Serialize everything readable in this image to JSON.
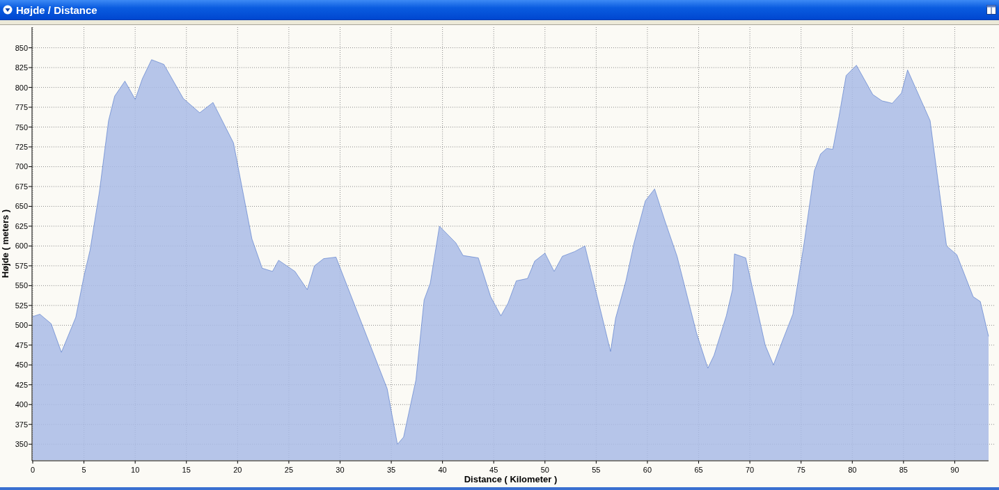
{
  "window": {
    "title": "Højde / Distance"
  },
  "chart": {
    "chart_data": {
      "type": "area",
      "xlabel": "Distance ( Kilometer )",
      "ylabel": "Højde ( meters )",
      "x": [
        0,
        0.7,
        1.8,
        2.8,
        4.2,
        5,
        5.6,
        6.5,
        7.4,
        8,
        9,
        10,
        10.7,
        11.6,
        12.8,
        14.7,
        16.3,
        17.6,
        19.6,
        21.4,
        22.4,
        23.4,
        24,
        25.6,
        26.8,
        27.5,
        28.4,
        29.6,
        34.6,
        35.6,
        36.2,
        37.4,
        38.2,
        38.8,
        39.7,
        41.3,
        42,
        43.5,
        44.7,
        45.7,
        46.4,
        47.2,
        48.3,
        49,
        50,
        50.9,
        51.7,
        52.9,
        53.9,
        56.4,
        56.9,
        57.9,
        58.7,
        59.8,
        60.7,
        61.7,
        62.9,
        64.8,
        65.9,
        66.5,
        67.7,
        68.3,
        68.5,
        69.6,
        71.5,
        72.3,
        73.2,
        74.2,
        75.3,
        76.3,
        76.9,
        77.5,
        78.1,
        78.7,
        79.4,
        80.4,
        82,
        82.9,
        83.9,
        84.8,
        85.4,
        87.6,
        89.2,
        90.2,
        91.8,
        92.5,
        93.3
      ],
      "values": [
        511,
        514,
        502,
        466,
        510,
        562,
        595,
        668,
        758,
        789,
        808,
        785,
        811,
        835,
        829,
        786,
        768,
        781,
        730,
        609,
        572,
        568,
        582,
        568,
        545,
        575,
        584,
        586,
        420,
        350,
        359,
        431,
        532,
        553,
        625,
        604,
        588,
        585,
        536,
        512,
        528,
        556,
        559,
        581,
        591,
        568,
        587,
        593,
        600,
        467,
        509,
        556,
        604,
        657,
        672,
        632,
        587,
        490,
        446,
        462,
        512,
        545,
        590,
        585,
        475,
        450,
        481,
        514,
        604,
        695,
        716,
        723,
        722,
        763,
        815,
        828,
        791,
        783,
        780,
        793,
        822,
        758,
        600,
        589,
        536,
        530,
        486
      ],
      "grid": true,
      "xlim": [
        0,
        93.3
      ],
      "ylim": [
        330,
        876
      ],
      "xticks": [
        0,
        5,
        10,
        15,
        20,
        25,
        30,
        35,
        40,
        45,
        50,
        55,
        60,
        65,
        70,
        75,
        80,
        85,
        90
      ],
      "yticks": [
        350,
        375,
        400,
        425,
        450,
        475,
        500,
        525,
        550,
        575,
        600,
        625,
        650,
        675,
        700,
        725,
        750,
        775,
        800,
        825,
        850
      ]
    }
  }
}
